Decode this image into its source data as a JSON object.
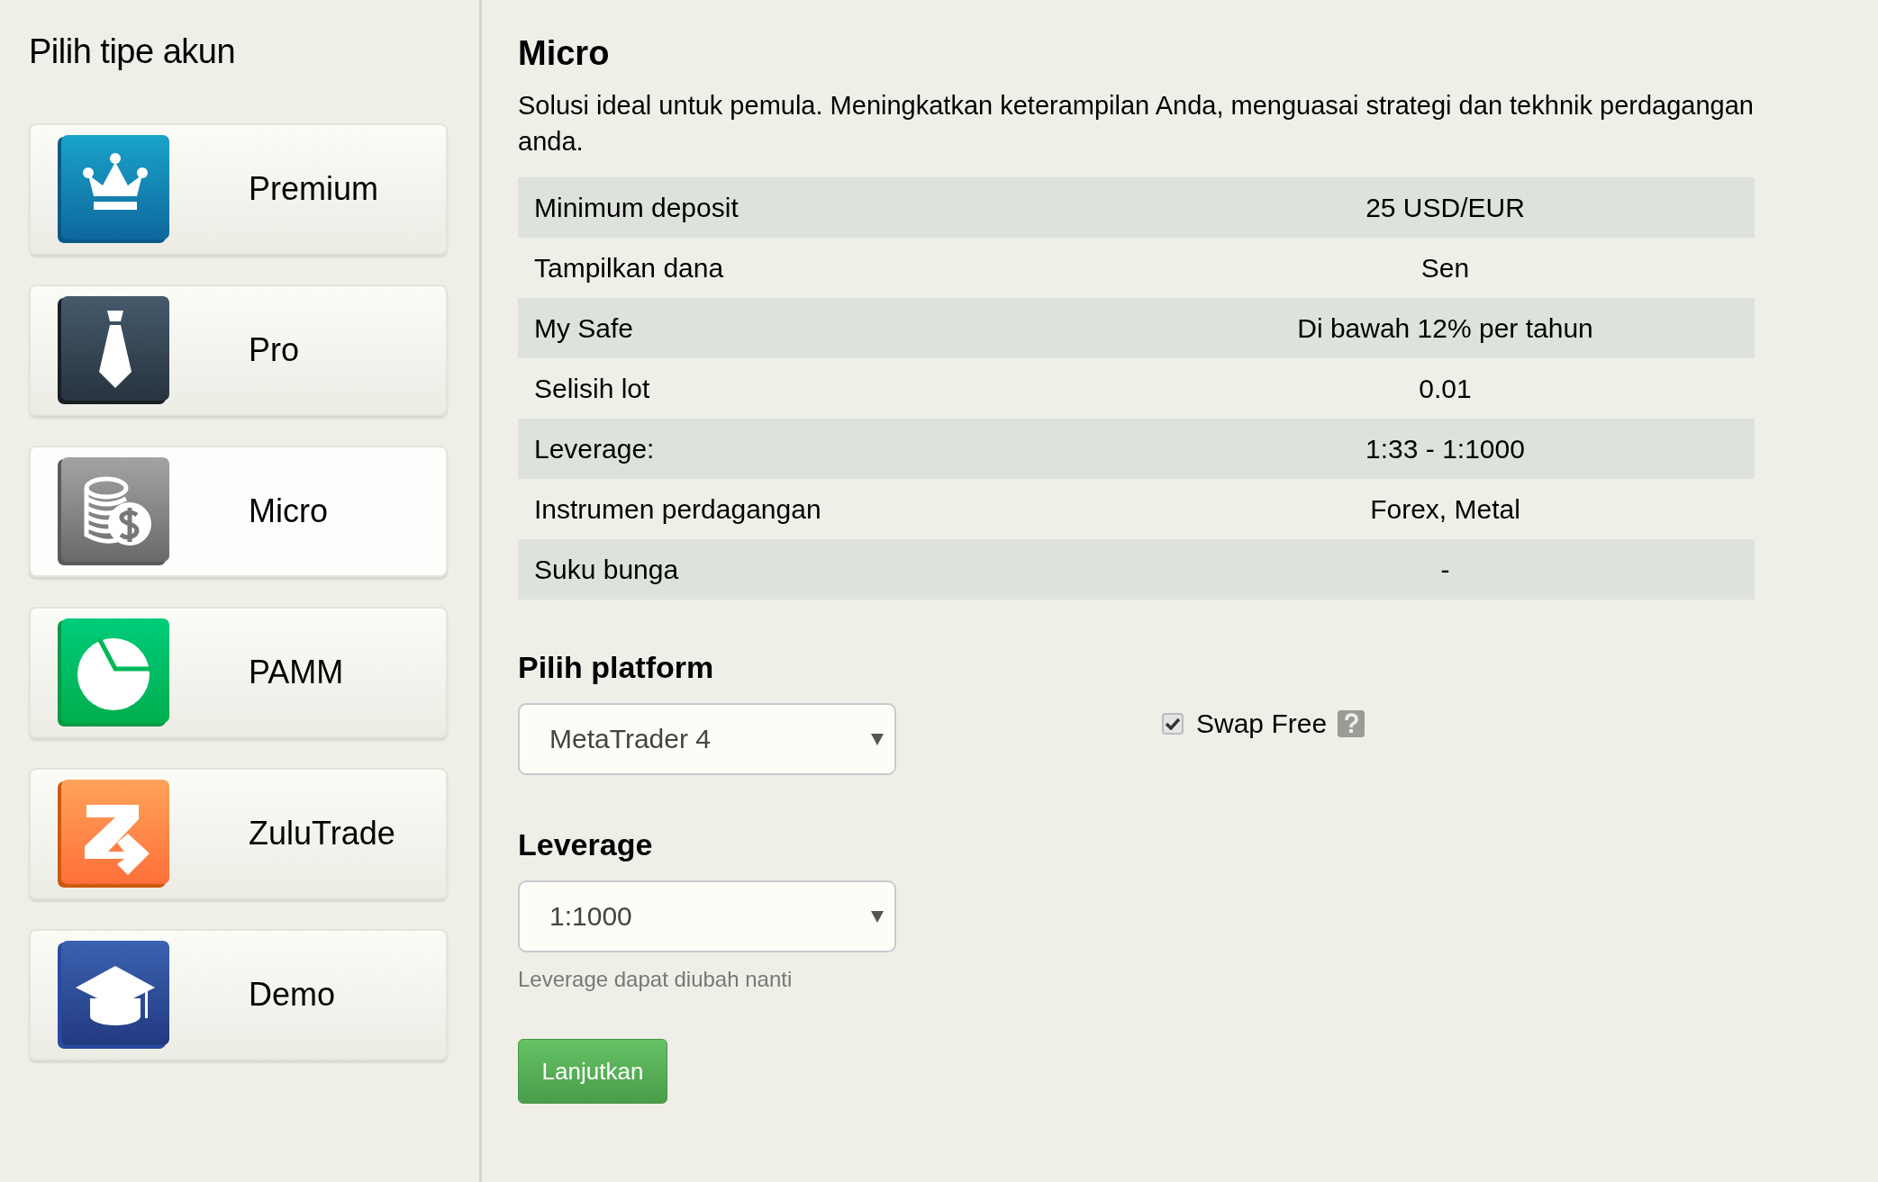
{
  "sidebar": {
    "title": "Pilih tipe akun",
    "items": [
      {
        "label": "Premium",
        "kind": "crown",
        "selected": false
      },
      {
        "label": "Pro",
        "kind": "tie",
        "selected": false
      },
      {
        "label": "Micro",
        "kind": "coins",
        "selected": true
      },
      {
        "label": "PAMM",
        "kind": "pie",
        "selected": false
      },
      {
        "label": "ZuluTrade",
        "kind": "zulu",
        "selected": false
      },
      {
        "label": "Demo",
        "kind": "cap",
        "selected": false
      }
    ]
  },
  "account": {
    "title": "Micro",
    "description": "Solusi ideal untuk pemula. Meningkatkan keterampilan Anda, menguasai strategi dan tekhnik perdagangan anda.",
    "rows": [
      {
        "label": "Minimum deposit",
        "value": "25 USD/EUR"
      },
      {
        "label": "Tampilkan dana",
        "value": "Sen"
      },
      {
        "label": "My Safe",
        "value": "Di bawah 12% per tahun"
      },
      {
        "label": "Selisih lot",
        "value": "0.01"
      },
      {
        "label": "Leverage:",
        "value": "1:33 - 1:1000"
      },
      {
        "label": "Instrumen perdagangan",
        "value": "Forex, Metal"
      },
      {
        "label": "Suku bunga",
        "value": "-"
      }
    ]
  },
  "platform": {
    "heading": "Pilih platform",
    "value": "MetaTrader 4",
    "swap_free": {
      "label": "Swap Free",
      "checked": true
    }
  },
  "leverage": {
    "heading": "Leverage",
    "value": "1:1000",
    "hint": "Leverage dapat diubah nanti"
  },
  "submit": "Lanjutkan"
}
